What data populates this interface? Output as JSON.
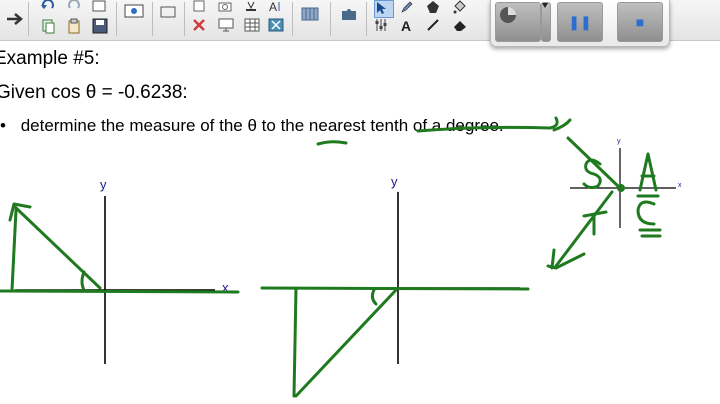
{
  "toolbar": {
    "buttons": [
      {
        "name": "forward-arrow-icon",
        "glyph": "➔"
      },
      {
        "name": "undo-icon",
        "glyph": "↶"
      },
      {
        "name": "redo-icon",
        "glyph": "↷"
      },
      {
        "name": "page-icon",
        "glyph": "▤"
      },
      {
        "name": "screen-capture-icon",
        "glyph": "▣"
      },
      {
        "name": "record-icon",
        "glyph": "▭"
      },
      {
        "name": "select-arrow-icon",
        "glyph": "↖"
      },
      {
        "name": "pen-icon",
        "glyph": "✎"
      },
      {
        "name": "shape-icon",
        "glyph": "⬟"
      },
      {
        "name": "fill-icon",
        "glyph": "⟟"
      },
      {
        "name": "copy-icon",
        "glyph": "⧉"
      },
      {
        "name": "paste-icon",
        "glyph": "⎘"
      },
      {
        "name": "save-icon",
        "glyph": "▪"
      },
      {
        "name": "delete-icon",
        "glyph": "✕"
      },
      {
        "name": "display-icon",
        "glyph": "▭"
      },
      {
        "name": "table-icon",
        "glyph": "▦"
      },
      {
        "name": "close-box-icon",
        "glyph": "☒"
      },
      {
        "name": "measure-icon",
        "glyph": "⊞"
      },
      {
        "name": "puzzle-icon",
        "glyph": "✚"
      },
      {
        "name": "text-icon",
        "glyph": "A"
      },
      {
        "name": "eraser-icon",
        "glyph": "◆"
      }
    ]
  },
  "recorder": {
    "pause_glyph": "❚❚",
    "stop_glyph": "■"
  },
  "content": {
    "title": "Example #5:",
    "given": "Given cos  θ  = -0.6238:",
    "bullet": "•",
    "instruction_start": "determine the measure of the ",
    "theta": "θ",
    "instruction_end": " to the nearest tenth of a degree."
  },
  "axes": {
    "left_y": "y",
    "left_x": "x",
    "middle_y": "y",
    "small_y": "y",
    "small_x": "x"
  },
  "annotations": {
    "q2": "S",
    "q1": "A",
    "q3": "T",
    "q4": "C"
  },
  "colors": {
    "ink": "#1f7a1f",
    "axis": "#000000",
    "axis_label": "#1a1a8c"
  }
}
